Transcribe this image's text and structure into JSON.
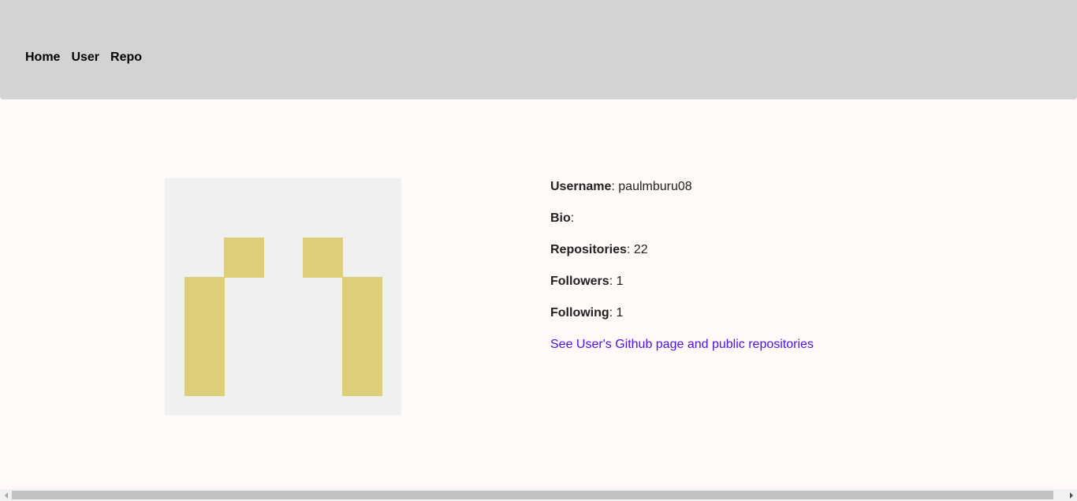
{
  "nav": {
    "items": [
      {
        "label": "Home"
      },
      {
        "label": "User"
      },
      {
        "label": "Repo"
      }
    ]
  },
  "avatar": {
    "icon": "identicon",
    "background_color": "#f0f0f0",
    "foreground_color": "#ddce7a"
  },
  "profile": {
    "username_label": "Username",
    "username_value": ": paulmburu08",
    "bio_label": "Bio",
    "bio_value": ":",
    "repos_label": "Repositories",
    "repos_value": ": 22",
    "followers_label": "Followers",
    "followers_value": ": 1",
    "following_label": "Following",
    "following_value": ": 1",
    "github_link": "See User's Github page and public repositories"
  },
  "colors": {
    "navbar_bg": "#d3d3d3",
    "page_bg": "#fffaf8",
    "link": "#4e13e6"
  }
}
